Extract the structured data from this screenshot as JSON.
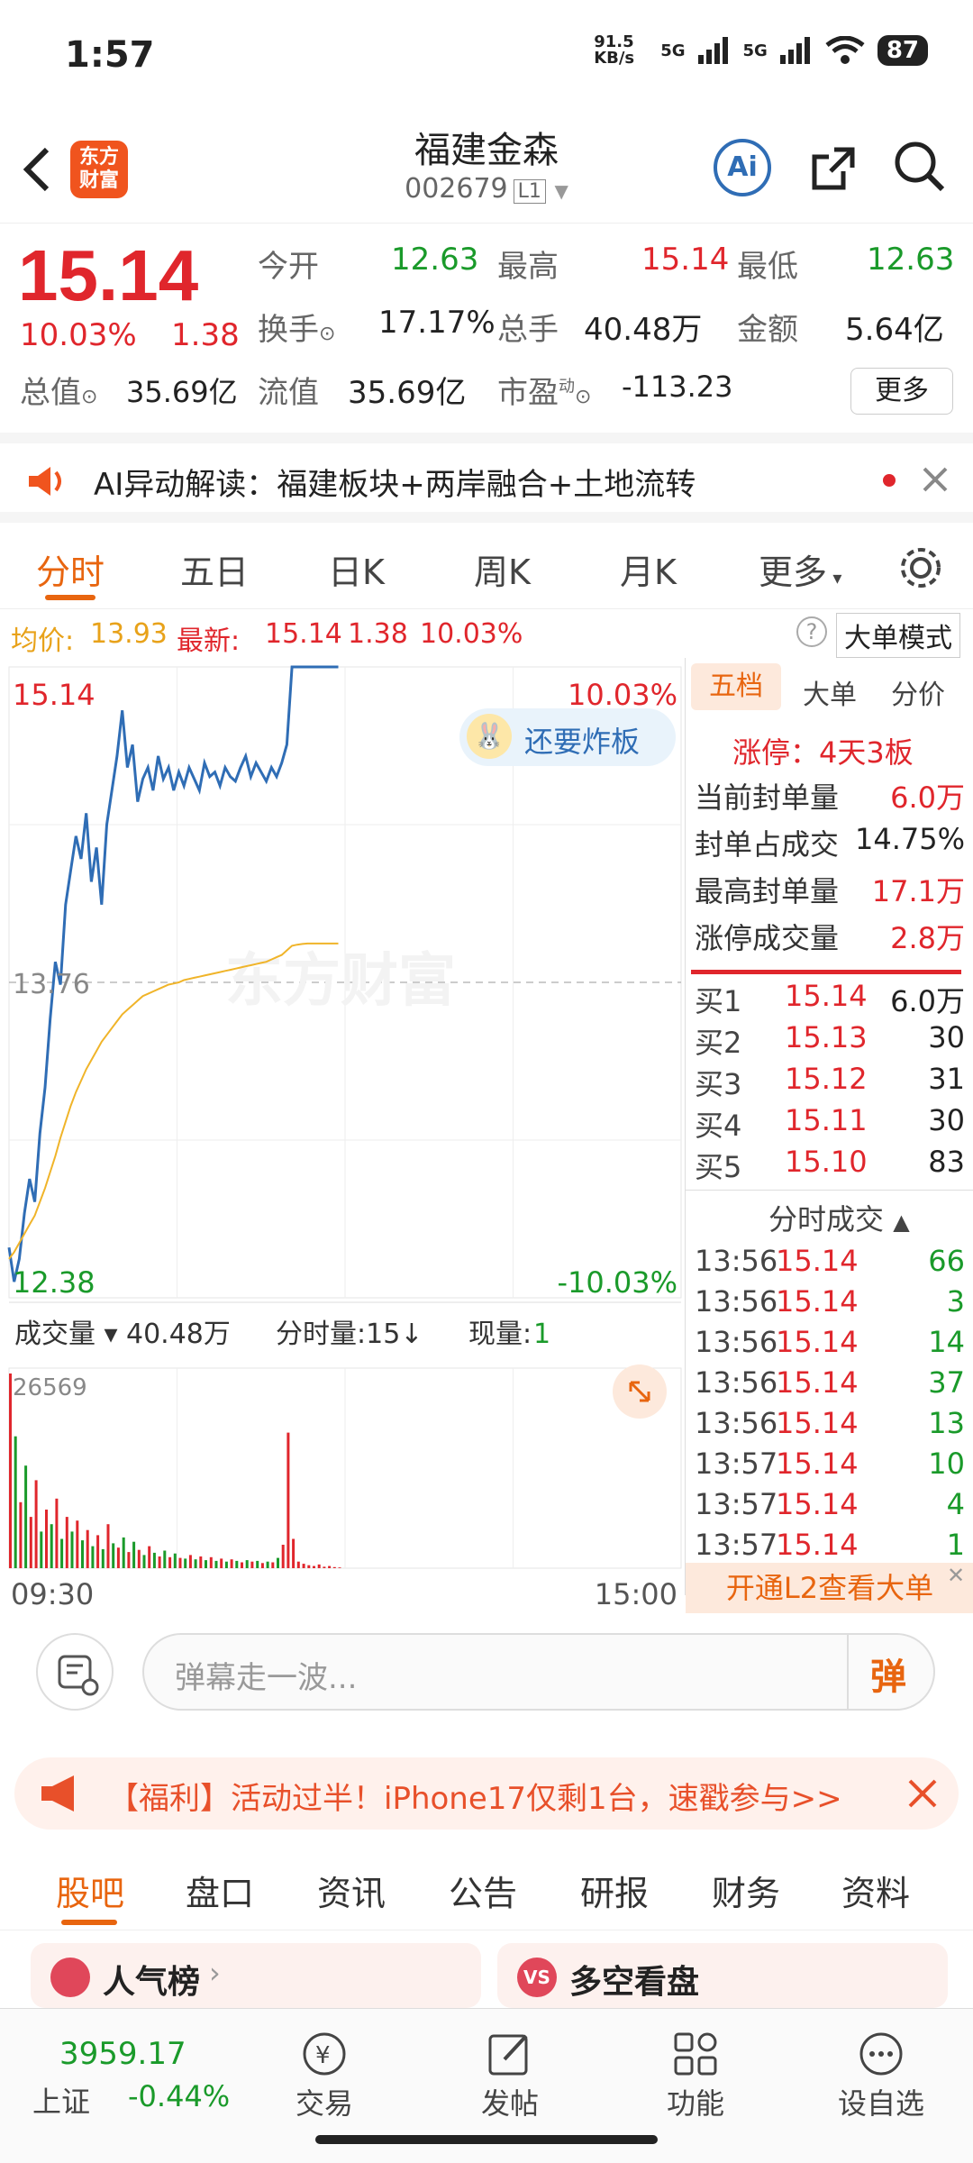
{
  "status": {
    "time": "1:57",
    "net_speed": "91.5 KB/s",
    "signal1": "5G",
    "signal2": "5G",
    "battery": "87"
  },
  "header": {
    "logo_line1": "东方",
    "logo_line2": "财富",
    "title": "福建金森",
    "code": "002679",
    "level": "L1",
    "ai_label": "Ai"
  },
  "quote": {
    "price": "15.14",
    "pct": "10.03%",
    "change": "1.38",
    "open_label": "今开",
    "open": "12.63",
    "high_label": "最高",
    "high": "15.14",
    "low_label": "最低",
    "low": "12.63",
    "turnover_label": "换手",
    "turnover": "17.17%",
    "volume_label": "总手",
    "volume": "40.48万",
    "amount_label": "金额",
    "amount": "5.64亿",
    "mcap_label": "总值",
    "mcap": "35.69亿",
    "float_label": "流值",
    "float": "35.69亿",
    "pe_label": "市盈",
    "pe_sup": "动",
    "pe": "-113.23",
    "more_label": "更多"
  },
  "ai_banner": {
    "text": "AI异动解读：福建板块+两岸融合+土地流转"
  },
  "tabs": [
    "分时",
    "五日",
    "日K",
    "周K",
    "月K",
    "更多"
  ],
  "info": {
    "avg_label": "均价:",
    "avg": "13.93",
    "latest_label": "最新:",
    "latest": "15.14",
    "chg": "1.38",
    "pct": "10.03%",
    "mode": "大单模式"
  },
  "chart_data": {
    "type": "line",
    "y_max_label": "15.14",
    "y_max_pct": "10.03%",
    "y_mid_label": "13.76",
    "y_min_label": "12.38",
    "y_min_pct": "-10.03%",
    "x_start": "09:30",
    "x_end": "15:00",
    "ylim": [
      12.38,
      15.14
    ],
    "watermark": "东方财富",
    "badge": "还要炸板",
    "series": [
      {
        "name": "price",
        "color": "#2f6db5",
        "values": [
          12.6,
          12.45,
          12.55,
          12.75,
          12.9,
          12.8,
          13.1,
          13.3,
          13.6,
          13.85,
          13.75,
          14.1,
          14.25,
          14.4,
          14.3,
          14.5,
          14.2,
          14.35,
          14.1,
          14.45,
          14.6,
          14.75,
          14.95,
          14.7,
          14.8,
          14.55,
          14.65,
          14.7,
          14.6,
          14.75,
          14.65,
          14.7,
          14.6,
          14.68,
          14.62,
          14.7,
          14.65,
          14.6,
          14.72,
          14.66,
          14.68,
          14.62,
          14.7,
          14.66,
          14.64,
          14.7,
          14.75,
          14.66,
          14.72,
          14.68,
          14.64,
          14.7,
          14.66,
          14.72,
          14.8,
          15.14,
          15.14,
          15.14,
          15.14,
          15.14,
          15.14,
          15.14,
          15.14,
          15.14,
          15.14
        ]
      },
      {
        "name": "avg",
        "color": "#f0b429",
        "values": [
          12.55,
          12.58,
          12.62,
          12.66,
          12.7,
          12.74,
          12.8,
          12.86,
          12.93,
          13.0,
          13.08,
          13.15,
          13.22,
          13.28,
          13.33,
          13.38,
          13.42,
          13.46,
          13.5,
          13.53,
          13.56,
          13.59,
          13.62,
          13.64,
          13.66,
          13.68,
          13.7,
          13.71,
          13.72,
          13.73,
          13.74,
          13.75,
          13.755,
          13.76,
          13.77,
          13.775,
          13.78,
          13.785,
          13.79,
          13.795,
          13.8,
          13.805,
          13.81,
          13.815,
          13.82,
          13.825,
          13.83,
          13.835,
          13.84,
          13.845,
          13.85,
          13.86,
          13.87,
          13.88,
          13.9,
          13.92,
          13.925,
          13.928,
          13.93,
          13.93,
          13.93,
          13.93,
          13.93,
          13.93,
          13.93
        ]
      }
    ],
    "volume": {
      "label": "成交量",
      "total": "40.48万",
      "unit_label": "分时量:15",
      "now_label": "现量:",
      "now": "1",
      "max_label": "26569",
      "bars": [
        26569,
        18000,
        9000,
        14000,
        7000,
        12000,
        5000,
        8000,
        6000,
        9500,
        4000,
        7000,
        5000,
        6500,
        3800,
        5200,
        3000,
        4500,
        2600,
        6000,
        3400,
        2800,
        4200,
        2200,
        3600,
        2500,
        1800,
        3000,
        2100,
        1600,
        2400,
        1500,
        2000,
        1400,
        1300,
        1800,
        1200,
        1600,
        1100,
        1500,
        1000,
        1300,
        900,
        1200,
        1000,
        800,
        1100,
        900,
        1000,
        700,
        900,
        800,
        1400,
        3200,
        18500,
        4000,
        900,
        600,
        400,
        300,
        500,
        200,
        300,
        150,
        100
      ],
      "colors": [
        "r",
        "g",
        "r",
        "g",
        "r",
        "r",
        "g",
        "r",
        "g",
        "r",
        "g",
        "r",
        "g",
        "r",
        "g",
        "r",
        "g",
        "r",
        "g",
        "r",
        "g",
        "r",
        "g",
        "r",
        "g",
        "r",
        "g",
        "r",
        "g",
        "r",
        "g",
        "r",
        "g",
        "r",
        "g",
        "r",
        "g",
        "r",
        "g",
        "r",
        "g",
        "r",
        "g",
        "r",
        "g",
        "r",
        "g",
        "r",
        "g",
        "r",
        "g",
        "r",
        "g",
        "r",
        "r",
        "r",
        "r",
        "r",
        "r",
        "r",
        "r",
        "r",
        "r",
        "r",
        "r"
      ]
    }
  },
  "panel": {
    "tabs": [
      "五档",
      "大单",
      "分价"
    ],
    "limit_up": "涨停：4天3板",
    "stats": [
      {
        "label": "当前封单量",
        "value": "6.0万"
      },
      {
        "label": "封单占成交",
        "value": "14.75%"
      },
      {
        "label": "最高封单量",
        "value": "17.1万"
      },
      {
        "label": "涨停成交量",
        "value": "2.8万"
      }
    ],
    "bids": [
      {
        "label": "买1",
        "price": "15.14",
        "vol": "6.0万"
      },
      {
        "label": "买2",
        "price": "15.13",
        "vol": "30"
      },
      {
        "label": "买3",
        "price": "15.12",
        "vol": "31"
      },
      {
        "label": "买4",
        "price": "15.11",
        "vol": "30"
      },
      {
        "label": "买5",
        "price": "15.10",
        "vol": "83"
      }
    ],
    "ticks_title": "分时成交",
    "ticks": [
      {
        "time": "13:56",
        "price": "15.14",
        "vol": "66"
      },
      {
        "time": "13:56",
        "price": "15.14",
        "vol": "3"
      },
      {
        "time": "13:56",
        "price": "15.14",
        "vol": "14"
      },
      {
        "time": "13:56",
        "price": "15.14",
        "vol": "37"
      },
      {
        "time": "13:56",
        "price": "15.14",
        "vol": "13"
      },
      {
        "time": "13:57",
        "price": "15.14",
        "vol": "10"
      },
      {
        "time": "13:57",
        "price": "15.14",
        "vol": "4"
      },
      {
        "time": "13:57",
        "price": "15.14",
        "vol": "1"
      }
    ],
    "l2_banner": "开通L2查看大单"
  },
  "danmu": {
    "placeholder": "弹幕走一波...",
    "send": "弹"
  },
  "promo": {
    "text": "【福利】活动过半！iPhone17仅剩1台，速戳参与>>"
  },
  "bottom_tabs": [
    "股吧",
    "盘口",
    "资讯",
    "公告",
    "研报",
    "财务",
    "资料"
  ],
  "cards": [
    {
      "title": "人气榜"
    },
    {
      "title": "多空看盘",
      "badge": "VS"
    }
  ],
  "nav": {
    "index_value": "3959.17",
    "index_name": "上证",
    "index_chg": "-0.44%",
    "items": [
      "交易",
      "发帖",
      "功能",
      "设自选"
    ]
  }
}
